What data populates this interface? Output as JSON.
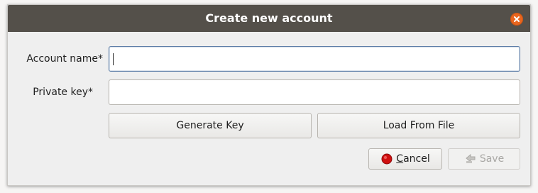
{
  "dialog": {
    "title": "Create new account",
    "close_icon": "close-icon"
  },
  "form": {
    "account_name": {
      "label": "Account name*",
      "value": ""
    },
    "private_key": {
      "label": "Private key*",
      "value": ""
    }
  },
  "actions": {
    "generate_key_label": "Generate Key",
    "load_from_file_label": "Load From File",
    "cancel_label": "Cancel",
    "cancel_icon": "stop-icon",
    "save_label": "Save",
    "save_icon": "save-icon"
  },
  "colors": {
    "titlebar": "#54504a",
    "close_button": "#e9661f",
    "cancel_icon": "#d01010",
    "focus_border": "#5e7ea8"
  }
}
